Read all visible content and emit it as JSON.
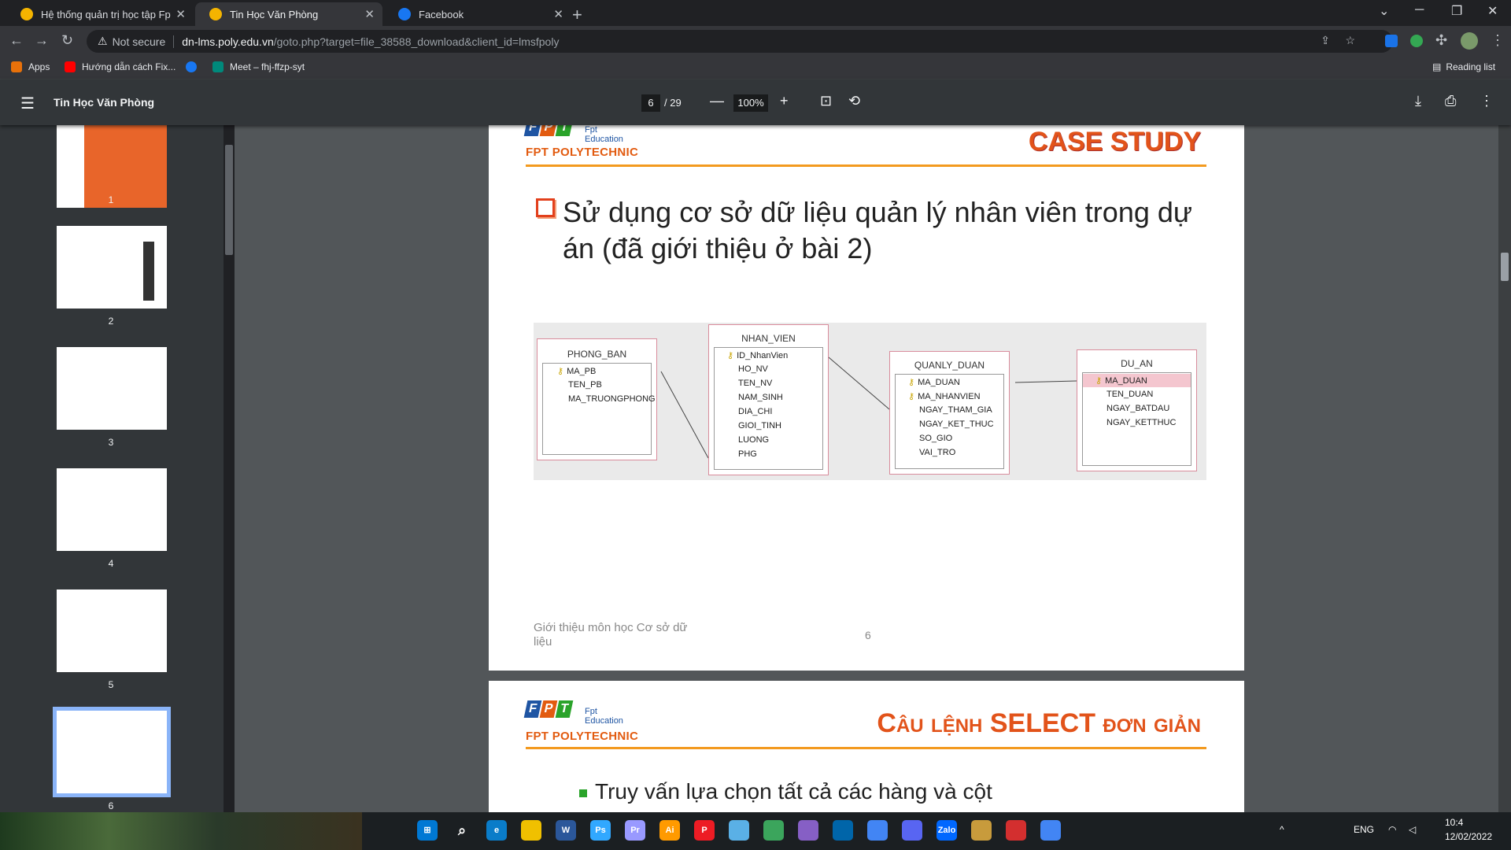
{
  "tabs": [
    {
      "title": "Hệ thống quản trị học tập Fpt Po",
      "active": false,
      "color": "#f4b400"
    },
    {
      "title": "Tin Học Văn Phòng",
      "active": true,
      "color": "#f4b400"
    },
    {
      "title": "Facebook",
      "active": false,
      "color": "#1877f2"
    }
  ],
  "omnibox": {
    "security": "Not secure",
    "host": "dn-lms.poly.edu.vn",
    "path": "/goto.php?target=file_38588_download&client_id=lmsfpoly"
  },
  "bookmarks": [
    {
      "label": "Apps",
      "color": "#e8710a"
    },
    {
      "label": "Hướng dẫn cách Fix...",
      "color": "#ff0000"
    },
    {
      "label": "",
      "color": "#1877f2"
    },
    {
      "label": "Meet – fhj-ffzp-syt",
      "color": "#00897b"
    }
  ],
  "reading_list": "Reading list",
  "pdf": {
    "title": "Tin Học Văn Phòng",
    "page": "6",
    "total": "/ 29",
    "zoom": "100%"
  },
  "thumbs": [
    "1",
    "2",
    "3",
    "4",
    "5",
    "6"
  ],
  "slide": {
    "edu": "Fpt Education",
    "poly": "FPT POLYTECHNIC",
    "case_study": "CASE STUDY",
    "heading": "Sử dụng cơ sở dữ liệu quản lý nhân viên trong dự án (đã giới thiệu ở bài 2)",
    "footer": "Giới thiệu môn học Cơ sở dữ liệu",
    "page_no": "6"
  },
  "erd": {
    "tables": [
      {
        "name": "PHONG_BAN",
        "fields": [
          {
            "n": "MA_PB",
            "k": true
          },
          {
            "n": "TEN_PB",
            "k": false
          },
          {
            "n": "MA_TRUONGPHONG",
            "k": false
          }
        ]
      },
      {
        "name": "NHAN_VIEN",
        "fields": [
          {
            "n": "ID_NhanVien",
            "k": true
          },
          {
            "n": "HO_NV",
            "k": false
          },
          {
            "n": "TEN_NV",
            "k": false
          },
          {
            "n": "NAM_SINH",
            "k": false
          },
          {
            "n": "DIA_CHI",
            "k": false
          },
          {
            "n": "GIOI_TINH",
            "k": false
          },
          {
            "n": "LUONG",
            "k": false
          },
          {
            "n": "PHG",
            "k": false
          }
        ]
      },
      {
        "name": "QUANLY_DUAN",
        "fields": [
          {
            "n": "MA_DUAN",
            "k": true
          },
          {
            "n": "MA_NHANVIEN",
            "k": true
          },
          {
            "n": "NGAY_THAM_GIA",
            "k": false
          },
          {
            "n": "NGAY_KET_THUC",
            "k": false
          },
          {
            "n": "SO_GIO",
            "k": false
          },
          {
            "n": "VAI_TRO",
            "k": false
          }
        ]
      },
      {
        "name": "DU_AN",
        "fields": [
          {
            "n": "MA_DUAN",
            "k": true
          },
          {
            "n": "TEN_DUAN",
            "k": false
          },
          {
            "n": "NGAY_BATDAU",
            "k": false
          },
          {
            "n": "NGAY_KETTHUC",
            "k": false
          }
        ]
      }
    ]
  },
  "slide2": {
    "edu": "Fpt Education",
    "poly": "FPT POLYTECHNIC",
    "title": "Câu lệnh SELECT đơn giản",
    "bullet": "Truy vấn lựa chọn tất cả các hàng và cột"
  },
  "taskbar": {
    "lang": "ENG",
    "date": "12/02/2022",
    "time": "10:4"
  }
}
